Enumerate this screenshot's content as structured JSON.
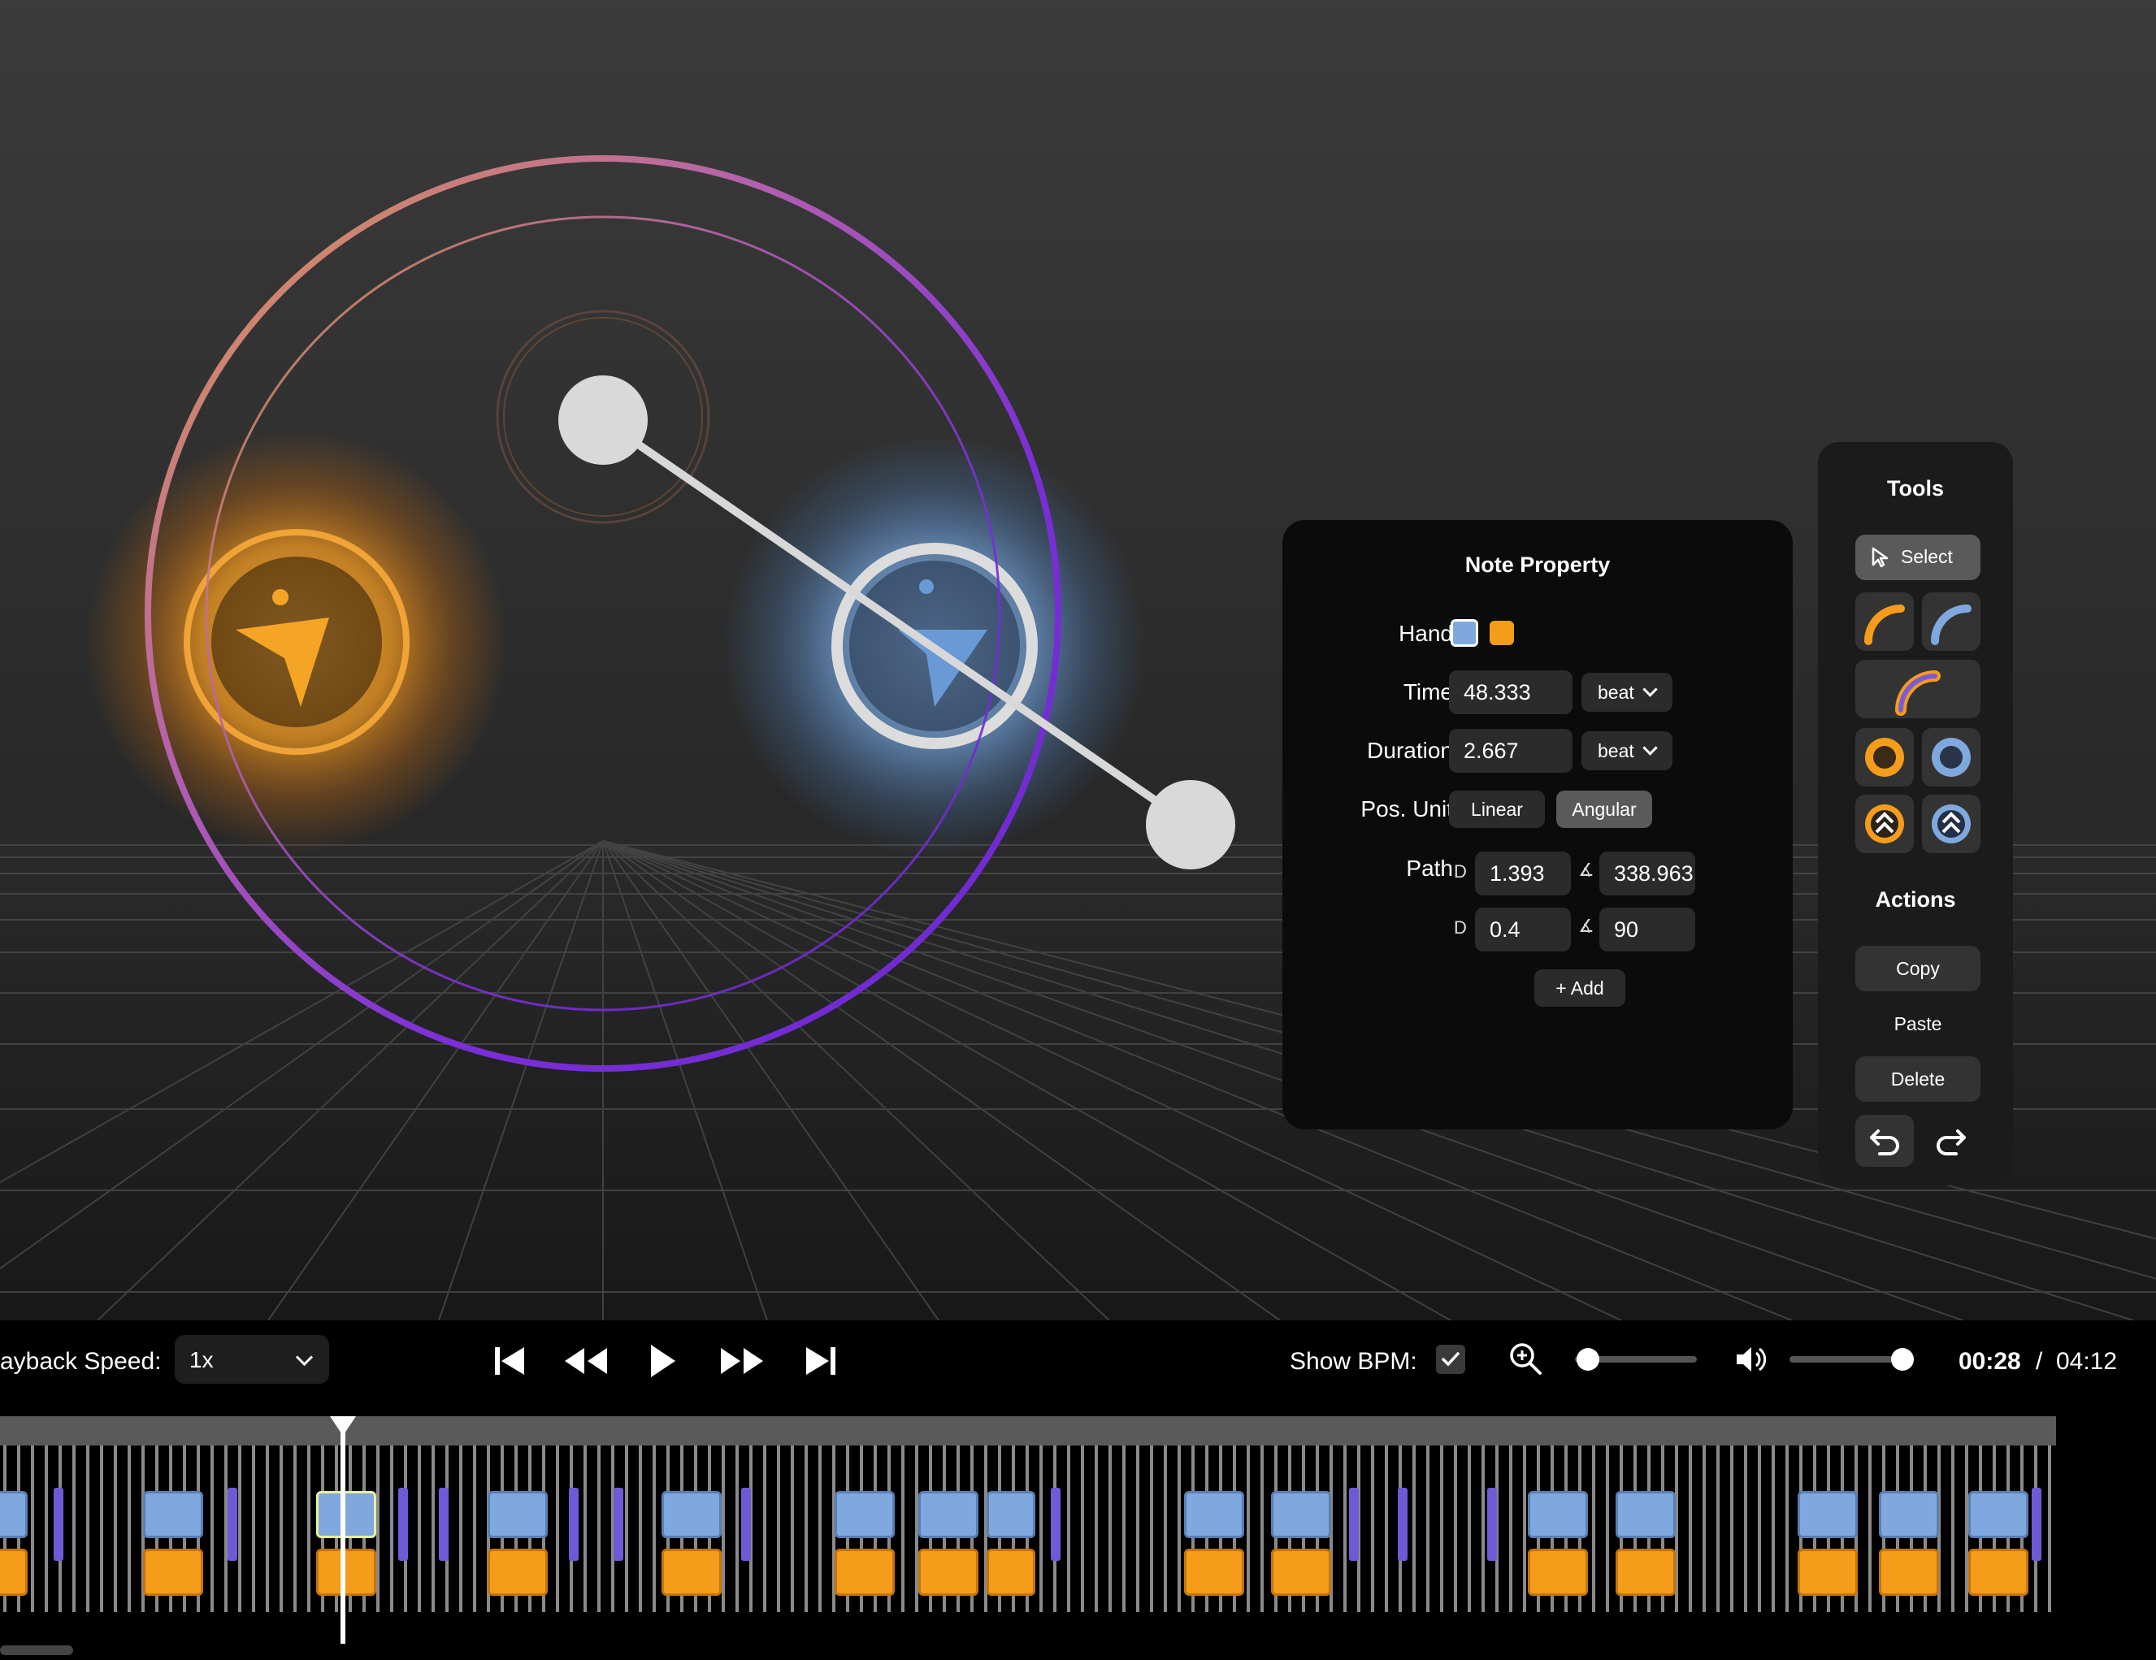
{
  "note_property": {
    "title": "Note Property",
    "hand_label": "Hand",
    "hand_colors": [
      "#7fa8de",
      "#f59c1a"
    ],
    "time_label": "Time",
    "time_value": "48.333",
    "time_unit": "beat",
    "duration_label": "Duration",
    "duration_value": "2.667",
    "duration_unit": "beat",
    "pos_unit_label": "Pos. Unit",
    "pos_unit_options": [
      "Linear",
      "Angular"
    ],
    "pos_unit_selected": "Angular",
    "path_label": "Path",
    "path_rows": [
      {
        "d_label": "D",
        "d_value": "1.393",
        "angle_label": "∡",
        "angle_value": "338.963"
      },
      {
        "d_label": "D",
        "d_value": "0.4",
        "angle_label": "∡",
        "angle_value": "90"
      }
    ],
    "add_label": "+ Add"
  },
  "tools": {
    "title": "Tools",
    "select_label": "Select",
    "actions_title": "Actions",
    "copy_label": "Copy",
    "paste_label": "Paste",
    "delete_label": "Delete",
    "icons": [
      "orange-arc-icon",
      "blue-arc-icon",
      "dual-arc-icon",
      "orange-ring-icon",
      "blue-ring-icon",
      "orange-chevron-icon",
      "blue-chevron-icon",
      "undo-icon",
      "redo-icon"
    ]
  },
  "controls": {
    "playback_speed_label": "ayback Speed:",
    "playback_speed_value": "1x",
    "show_bpm_label": "Show BPM:",
    "show_bpm_checked": true,
    "zoom_level": 0.1,
    "volume_level": 1.0,
    "time_current": "00:28",
    "time_separator": "/",
    "time_total": "04:12"
  },
  "colors": {
    "blue_hand": "#7fa8de",
    "orange_hand": "#f59c1a",
    "bpm_marker": "#6f5ad6",
    "ring": "#7b2fd6"
  }
}
